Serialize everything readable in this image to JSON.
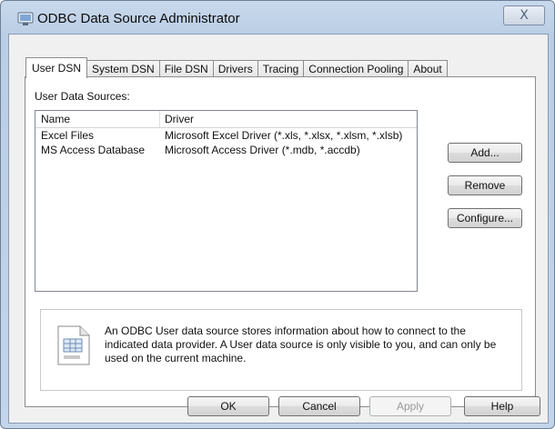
{
  "window": {
    "title": "ODBC Data Source Administrator",
    "icon": "odbc-app-icon",
    "close_glyph": "X"
  },
  "tabs": [
    {
      "label": "User DSN",
      "active": true
    },
    {
      "label": "System DSN"
    },
    {
      "label": "File DSN"
    },
    {
      "label": "Drivers"
    },
    {
      "label": "Tracing"
    },
    {
      "label": "Connection Pooling"
    },
    {
      "label": "About"
    }
  ],
  "user_dsn": {
    "section_label": "User Data Sources:",
    "columns": [
      "Name",
      "Driver"
    ],
    "rows": [
      {
        "name": "Excel Files",
        "driver": "Microsoft Excel Driver (*.xls, *.xlsx, *.xlsm, *.xlsb)"
      },
      {
        "name": "MS Access Database",
        "driver": "Microsoft Access Driver (*.mdb, *.accdb)"
      }
    ],
    "buttons": {
      "add": "Add...",
      "remove": "Remove",
      "configure": "Configure..."
    },
    "info_icon": "data-source-icon",
    "info_text": "An ODBC User data source stores information about how to connect to the indicated data provider.  A User data source is only visible to you, and can only be used on the current machine."
  },
  "footer": {
    "ok": "OK",
    "cancel": "Cancel",
    "apply": "Apply",
    "help": "Help"
  }
}
